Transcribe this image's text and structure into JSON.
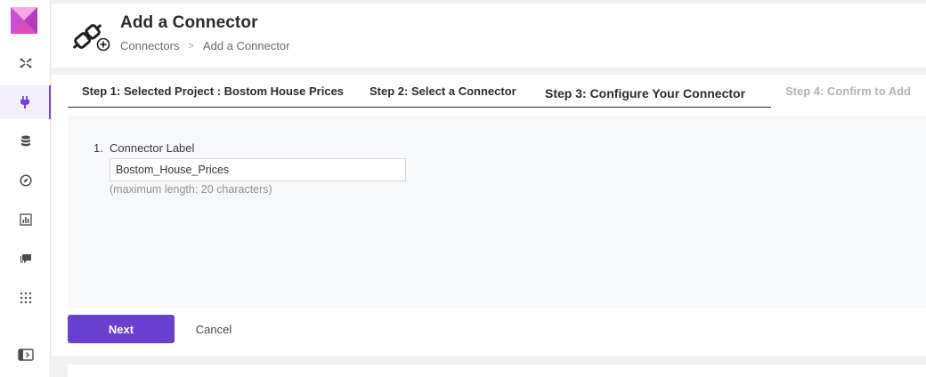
{
  "sidebar": {
    "items": [
      {
        "icon": "connections-icon",
        "active": false
      },
      {
        "icon": "connector-plug-icon",
        "active": true
      },
      {
        "icon": "database-icon",
        "active": false
      },
      {
        "icon": "compass-icon",
        "active": false
      },
      {
        "icon": "bar-chart-icon",
        "active": false
      },
      {
        "icon": "chat-icon",
        "active": false
      },
      {
        "icon": "apps-grid-icon",
        "active": false
      },
      {
        "icon": "collapse-sidebar-icon",
        "active": false
      }
    ],
    "accent_color": "#7a3fdc"
  },
  "header": {
    "title": "Add a Connector",
    "breadcrumb": {
      "root": "Connectors",
      "separator": ">",
      "current": "Add a Connector"
    }
  },
  "steps": [
    {
      "label": "Step 1: Selected Project : Bostom House Prices",
      "state": "done"
    },
    {
      "label": "Step 2: Select a Connector",
      "state": "done"
    },
    {
      "label": "Step 3: Configure Your Connector",
      "state": "current"
    },
    {
      "label": "Step 4: Confirm to Add",
      "state": "pending"
    }
  ],
  "form": {
    "number": "1.",
    "label": "Connector Label",
    "value": "Bostom_House_Prices",
    "hint": "(maximum length: 20 characters)"
  },
  "actions": {
    "next_label": "Next",
    "cancel_label": "Cancel",
    "primary_color": "#6b3fcf"
  }
}
